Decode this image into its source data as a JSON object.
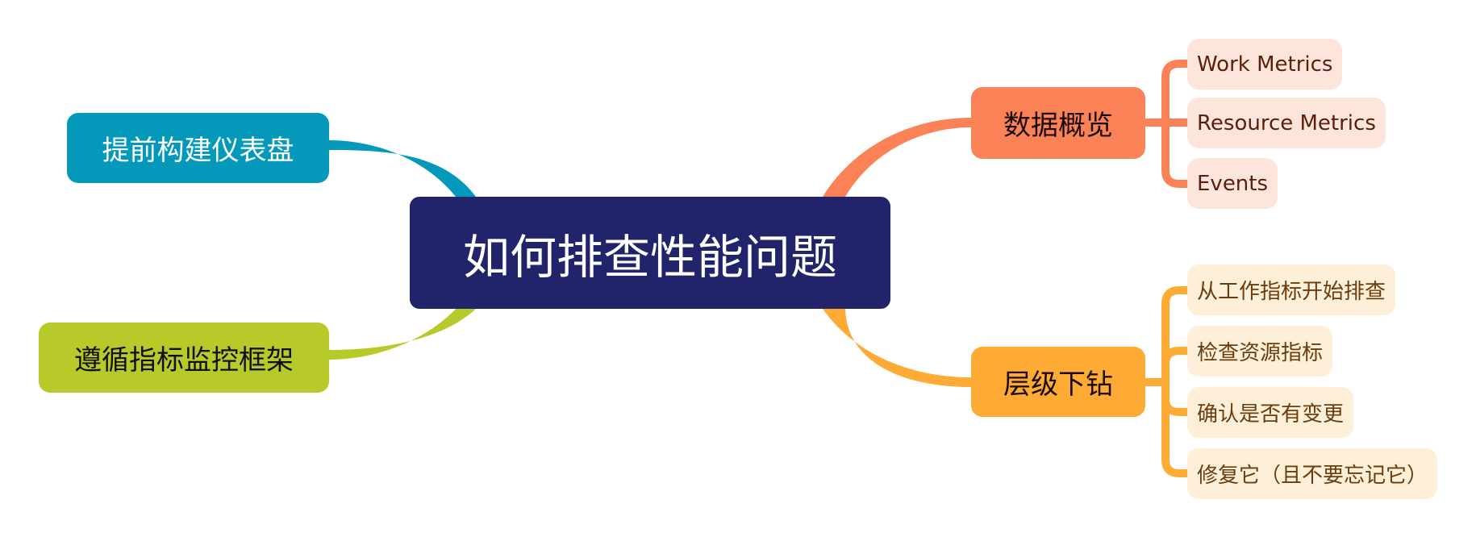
{
  "central_topic": "如何排查性能问题",
  "colors": {
    "central": "#21246a",
    "dashboards": "#0499bb",
    "framework": "#b8c92a",
    "data_overview": "#fb8257",
    "drill_down": "#fdab35",
    "data_overview_child_bg": "#fee5dc",
    "drill_down_child_bg": "#feefd9"
  },
  "branches": {
    "dashboards": {
      "label": "提前构建仪表盘"
    },
    "framework": {
      "label": "遵循指标监控框架"
    },
    "data_overview": {
      "label": "数据概览",
      "children": [
        "Work Metrics",
        "Resource Metrics",
        "Events"
      ]
    },
    "drill_down": {
      "label": "层级下钻",
      "children": [
        "从工作指标开始排查",
        "检查资源指标",
        "确认是否有变更",
        "修复它（且不要忘记它）"
      ]
    }
  }
}
